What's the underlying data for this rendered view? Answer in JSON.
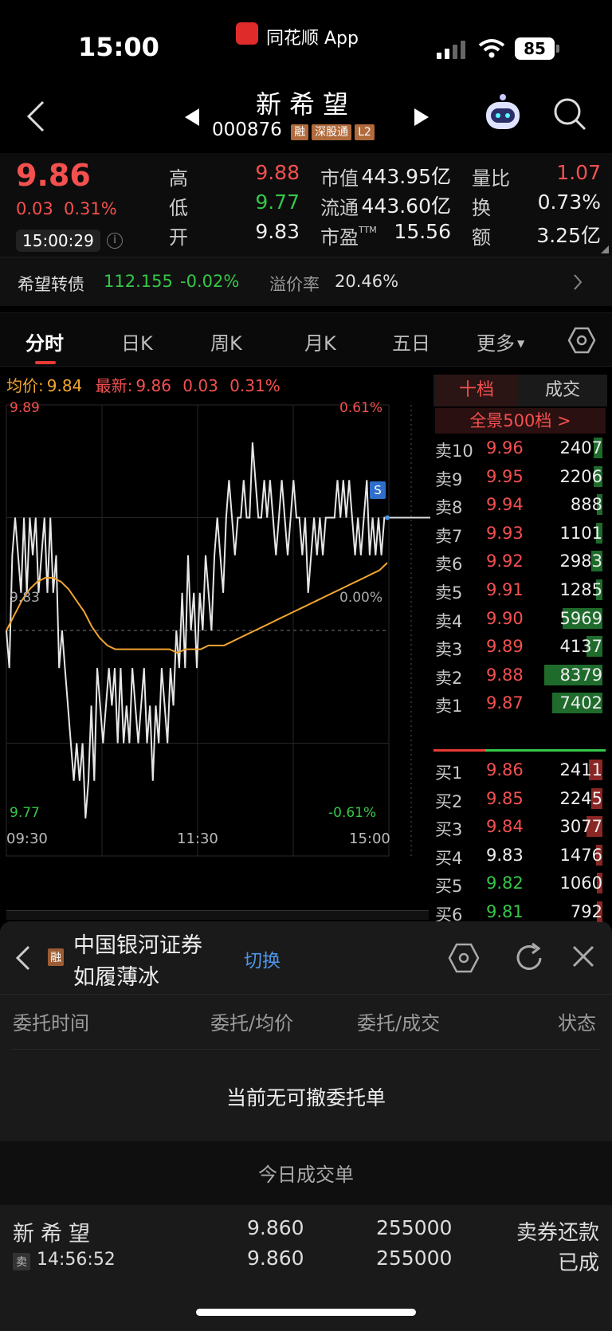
{
  "status_bar": {
    "time": "15:00",
    "app_name": "同花顺 App",
    "battery": "85"
  },
  "header": {
    "stock_name": "新希望",
    "stock_code": "000876",
    "badges": [
      "融",
      "深股通",
      "L2"
    ]
  },
  "quote": {
    "price": "9.86",
    "change": "0.03",
    "change_pct": "0.31%",
    "time": "15:00:29",
    "cells": [
      {
        "label": "高",
        "value": "9.88"
      },
      {
        "label": "低",
        "value": "9.77"
      },
      {
        "label": "开",
        "value": "9.83"
      },
      {
        "label": "市值",
        "value": "443.95亿"
      },
      {
        "label": "流通",
        "value": "443.60亿"
      },
      {
        "label": "市盈",
        "sup": "TTM",
        "value": "15.56"
      },
      {
        "label": "量比",
        "value": "1.07"
      },
      {
        "label": "换",
        "value": "0.73%"
      },
      {
        "label": "额",
        "value": "3.25亿"
      }
    ]
  },
  "bond": {
    "name": "希望转债",
    "price": "112.155",
    "change": "-0.02%",
    "premium_label": "溢价率",
    "premium": "20.46%"
  },
  "tabs": [
    "分时",
    "日K",
    "周K",
    "月K",
    "五日",
    "更多"
  ],
  "chart_info": {
    "avg_label": "均价:",
    "avg_value": "9.84",
    "latest_label": "最新:",
    "latest_value": "9.86",
    "latest_change": "0.03",
    "latest_pct": "0.31%"
  },
  "chart_data": {
    "type": "line",
    "y_axis_left": [
      "9.89",
      "9.83",
      "9.77"
    ],
    "y_axis_right": [
      "0.61%",
      "0.00%",
      "-0.61%"
    ],
    "x_labels": [
      "09:30",
      "11:30",
      "15:00"
    ],
    "ylim": [
      9.77,
      9.89
    ],
    "marker": "S",
    "series": [
      {
        "values": [
          9.83,
          9.82,
          9.85,
          9.86,
          9.85,
          9.84,
          9.86,
          9.84,
          9.86,
          9.85,
          9.86,
          9.84,
          9.85,
          9.86,
          9.84,
          9.86,
          9.84,
          9.85,
          9.82,
          9.83,
          9.82,
          9.81,
          9.8,
          9.79,
          9.8,
          9.79,
          9.8,
          9.78,
          9.79,
          9.81,
          9.79,
          9.82,
          9.81,
          9.8,
          9.81,
          9.82,
          9.81,
          9.82,
          9.8,
          9.82,
          9.8,
          9.81,
          9.8,
          9.82,
          9.81,
          9.8,
          9.81,
          9.82,
          9.8,
          9.81,
          9.79,
          9.81,
          9.8,
          9.82,
          9.81,
          9.8,
          9.82,
          9.81,
          9.83,
          9.82,
          9.84,
          9.82,
          9.85,
          9.83,
          9.84,
          9.82,
          9.84,
          9.83,
          9.85,
          9.84,
          9.83,
          9.85,
          9.86,
          9.85,
          9.84,
          9.86,
          9.87,
          9.86,
          9.85,
          9.86,
          9.86,
          9.87,
          9.86,
          9.86,
          9.88,
          9.87,
          9.86,
          9.86,
          9.87,
          9.86,
          9.87,
          9.86,
          9.85,
          9.86,
          9.87,
          9.86,
          9.85,
          9.86,
          9.87,
          9.86,
          9.86,
          9.85,
          9.86,
          9.84,
          9.85,
          9.86,
          9.85,
          9.86,
          9.85,
          9.86,
          9.86,
          9.86,
          9.86,
          9.87,
          9.86,
          9.87,
          9.86,
          9.87,
          9.86,
          9.85,
          9.86,
          9.85,
          9.86,
          9.87,
          9.85,
          9.86,
          9.85,
          9.86,
          9.85,
          9.86,
          9.86
        ]
      },
      {
        "values": [
          9.83,
          9.834,
          9.838,
          9.841,
          9.843,
          9.844,
          9.844,
          9.843,
          9.841,
          9.838,
          9.835,
          9.831,
          9.828,
          9.826,
          9.825,
          9.825,
          9.825,
          9.825,
          9.825,
          9.825,
          9.825,
          9.825,
          9.824,
          9.825,
          9.825,
          9.825,
          9.826,
          9.826,
          9.826,
          9.827,
          9.828,
          9.829,
          9.83,
          9.831,
          9.832,
          9.833,
          9.834,
          9.835,
          9.836,
          9.837,
          9.838,
          9.839,
          9.84,
          9.841,
          9.842,
          9.843,
          9.844,
          9.845,
          9.846,
          9.848
        ]
      }
    ]
  },
  "orderbook": {
    "tab_active": "十档",
    "tab_other": "成交",
    "banner": "全景500档 >",
    "asks": [
      {
        "label": "卖10",
        "price": "9.96",
        "volume": "2407",
        "fill": 0.08
      },
      {
        "label": "卖9",
        "price": "9.95",
        "volume": "2206",
        "fill": 0.08
      },
      {
        "label": "卖8",
        "price": "9.94",
        "volume": "888",
        "fill": 0.05
      },
      {
        "label": "卖7",
        "price": "9.93",
        "volume": "1101",
        "fill": 0.06
      },
      {
        "label": "卖6",
        "price": "9.92",
        "volume": "2983",
        "fill": 0.1
      },
      {
        "label": "卖5",
        "price": "9.91",
        "volume": "1285",
        "fill": 0.06
      },
      {
        "label": "卖4",
        "price": "9.90",
        "volume": "5969",
        "fill": 0.36
      },
      {
        "label": "卖3",
        "price": "9.89",
        "volume": "4137",
        "fill": 0.14
      },
      {
        "label": "卖2",
        "price": "9.88",
        "volume": "8379",
        "fill": 0.52
      },
      {
        "label": "卖1",
        "price": "9.87",
        "volume": "7402",
        "fill": 0.45
      }
    ],
    "bids": [
      {
        "label": "买1",
        "price": "9.86",
        "volume": "2411",
        "fill": 0.12
      },
      {
        "label": "买2",
        "price": "9.85",
        "volume": "2245",
        "fill": 0.1
      },
      {
        "label": "买3",
        "price": "9.84",
        "volume": "3077",
        "fill": 0.14
      },
      {
        "label": "买4",
        "price": "9.83",
        "volume": "1476",
        "fill": 0.06
      },
      {
        "label": "买5",
        "price": "9.82",
        "volume": "1060",
        "fill": 0.05
      },
      {
        "label": "买6",
        "price": "9.81",
        "volume": "792",
        "fill": 0.05
      }
    ]
  },
  "panel": {
    "broker_badge": "融",
    "broker": "中国银河证券",
    "account": "如履薄冰",
    "switch": "切换",
    "columns": [
      "委托时间",
      "委托/均价",
      "委托/成交",
      "状态"
    ],
    "empty_text": "当前无可撤委托单",
    "section_title": "今日成交单",
    "trade": {
      "name": "新希望",
      "side_badge": "卖",
      "time": "14:56:52",
      "price1": "9.860",
      "price2": "9.860",
      "qty1": "255000",
      "qty2": "255000",
      "type": "卖券还款",
      "status": "已成"
    }
  }
}
